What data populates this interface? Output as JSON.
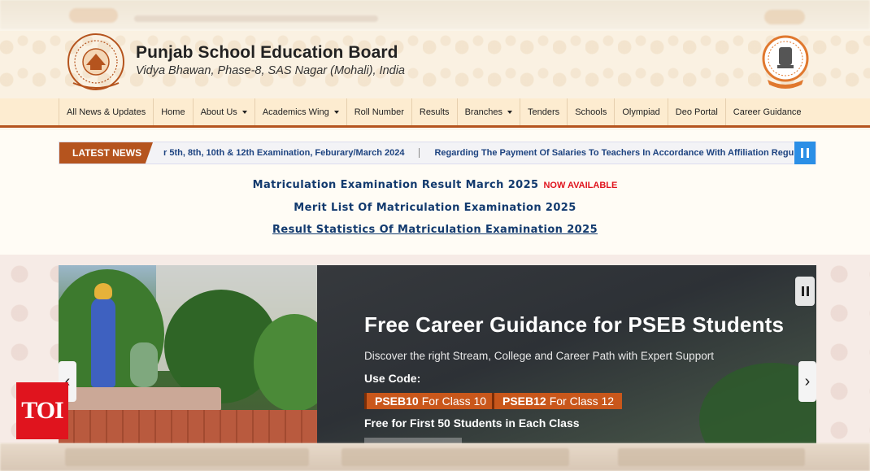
{
  "header": {
    "title": "Punjab School Education Board",
    "address": "Vidya Bhawan, Phase-8, SAS Nagar (Mohali), India"
  },
  "nav": {
    "items": [
      {
        "label": "All News & Updates",
        "dropdown": false
      },
      {
        "label": "Home",
        "dropdown": false
      },
      {
        "label": "About Us",
        "dropdown": true
      },
      {
        "label": "Academics Wing",
        "dropdown": true
      },
      {
        "label": "Roll Number",
        "dropdown": false
      },
      {
        "label": "Results",
        "dropdown": false
      },
      {
        "label": "Branches",
        "dropdown": true
      },
      {
        "label": "Tenders",
        "dropdown": false
      },
      {
        "label": "Schools",
        "dropdown": false
      },
      {
        "label": "Olympiad",
        "dropdown": false
      },
      {
        "label": "Deo Portal",
        "dropdown": false
      },
      {
        "label": "Career Guidance",
        "dropdown": false
      }
    ]
  },
  "ticker": {
    "label": "LATEST NEWS",
    "items": [
      "r 5th, 8th, 10th & 12th Examination, Feburary/March 2024",
      "Regarding The Payment Of Salaries To Teachers In Accordance With Affiliation Regulati"
    ]
  },
  "announcements": {
    "result": "Matriculation Examination Result March 2025",
    "badge": "NOW AVAILABLE",
    "merit": "Merit List Of Matriculation Examination 2025",
    "statistics": "Result Statistics Of Matriculation Examination 2025"
  },
  "slide": {
    "title": "Free Career Guidance for PSEB Students",
    "subtitle": "Discover the right Stream, College and Career Path with Expert Support",
    "code_label": "Use Code:",
    "code1": {
      "code": "PSEB10",
      "text": "For Class 10"
    },
    "code2": {
      "code": "PSEB12",
      "text": "For Class 12"
    },
    "free_text": "Free for First 50 Students in Each Class"
  },
  "watermark": "TOI",
  "colors": {
    "brand": "#b5541e",
    "link": "#123a6e",
    "badge": "#e0141e",
    "pause": "#2b8fe6"
  }
}
